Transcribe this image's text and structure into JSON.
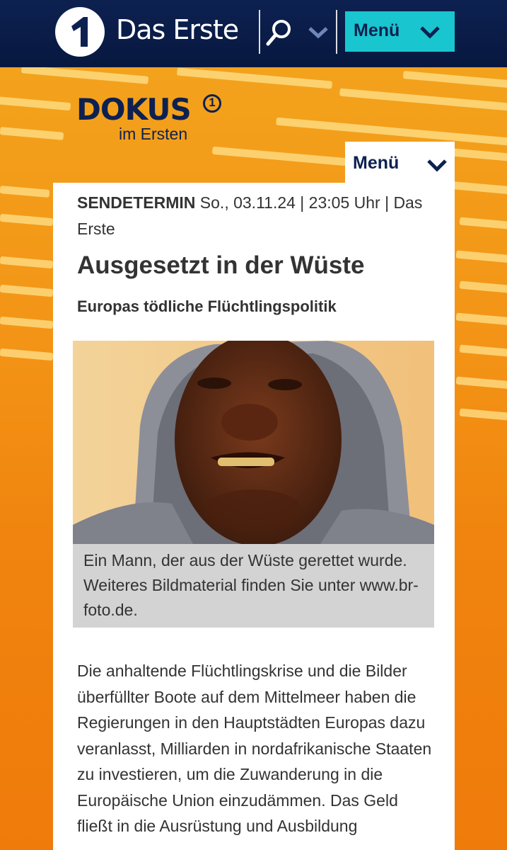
{
  "header": {
    "brand_name": "Das Erste",
    "logo_icon": "das-erste-one-logo",
    "search_icon": "search-icon",
    "dropdown_icon": "chevron-down-icon",
    "menu_label": "Menü"
  },
  "section": {
    "logo_title": "DOKUS",
    "logo_subtitle": "im Ersten",
    "logo_badge": "1",
    "menu_label": "Menü"
  },
  "article": {
    "sendetermin_label": "SENDETERMIN",
    "sendetermin_value": "So., 03.11.24 | 23:05 Uhr | Das Erste",
    "title": "Ausgesetzt in der Wüste",
    "subtitle": "Europas tödliche Flüchtlingspolitik",
    "image_caption": "Ein Mann, der aus der Wüste gerettet wurde. Weiteres Bildmaterial finden Sie unter www.br-foto.de.",
    "body": "Die anhaltende Flüchtlingskrise und die Bilder überfüllter Boote auf dem Mittelmeer haben die Regierungen in den Hauptstädten Europas dazu veranlasst, Milliarden in nordafrikanische Staaten zu investieren, um die Zuwanderung in die Europäische Union einzudämmen. Das Geld fließt in die Ausrüstung und Ausbildung"
  },
  "colors": {
    "navy": "#0d2151",
    "accent_cyan": "#19c6cf",
    "hero_orange": "#f08a10",
    "text": "#333333",
    "caption_bg": "#d3d3d3"
  }
}
